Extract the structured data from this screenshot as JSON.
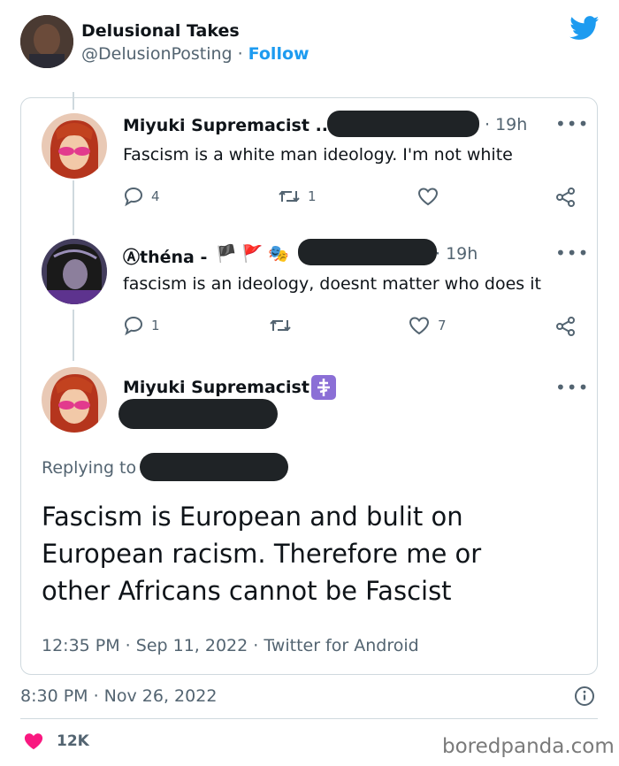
{
  "header": {
    "display_name": "Delusional Takes",
    "handle": "@DelusionPosting",
    "separator": "·",
    "follow_label": "Follow"
  },
  "quoted": {
    "tweets": [
      {
        "name": "Miyuki Supremacist ...",
        "time": "· 19h",
        "text": "Fascism is a white man ideology. I'm not white",
        "replies": "4",
        "retweets": "1",
        "likes": ""
      },
      {
        "name": "Ⓐthéna -",
        "emojis": "🏴 🚩 🎭",
        "time": "· 19h",
        "text": "fascism is an ideology, doesnt matter who does it",
        "replies": "1",
        "retweets": "",
        "likes": "7"
      }
    ],
    "main": {
      "name": "Miyuki Supremacist",
      "replying_to": "Replying to",
      "text": "Fascism is European and bulit on European racism. Therefore me or other Africans cannot be Fascist",
      "meta": "12:35 PM · Sep 11, 2022 · Twitter for Android"
    }
  },
  "footer": {
    "timestamp": "8:30 PM · Nov 26, 2022",
    "likes_count": "12K",
    "watermark": "boredpanda.com"
  },
  "colors": {
    "accent": "#1d9bf0",
    "like": "#f91880",
    "muted": "#536471"
  },
  "icons": [
    "twitter-bird-icon",
    "reply-icon",
    "retweet-icon",
    "like-icon",
    "share-icon",
    "more-icon",
    "info-icon",
    "heart-icon",
    "cross-icon"
  ]
}
